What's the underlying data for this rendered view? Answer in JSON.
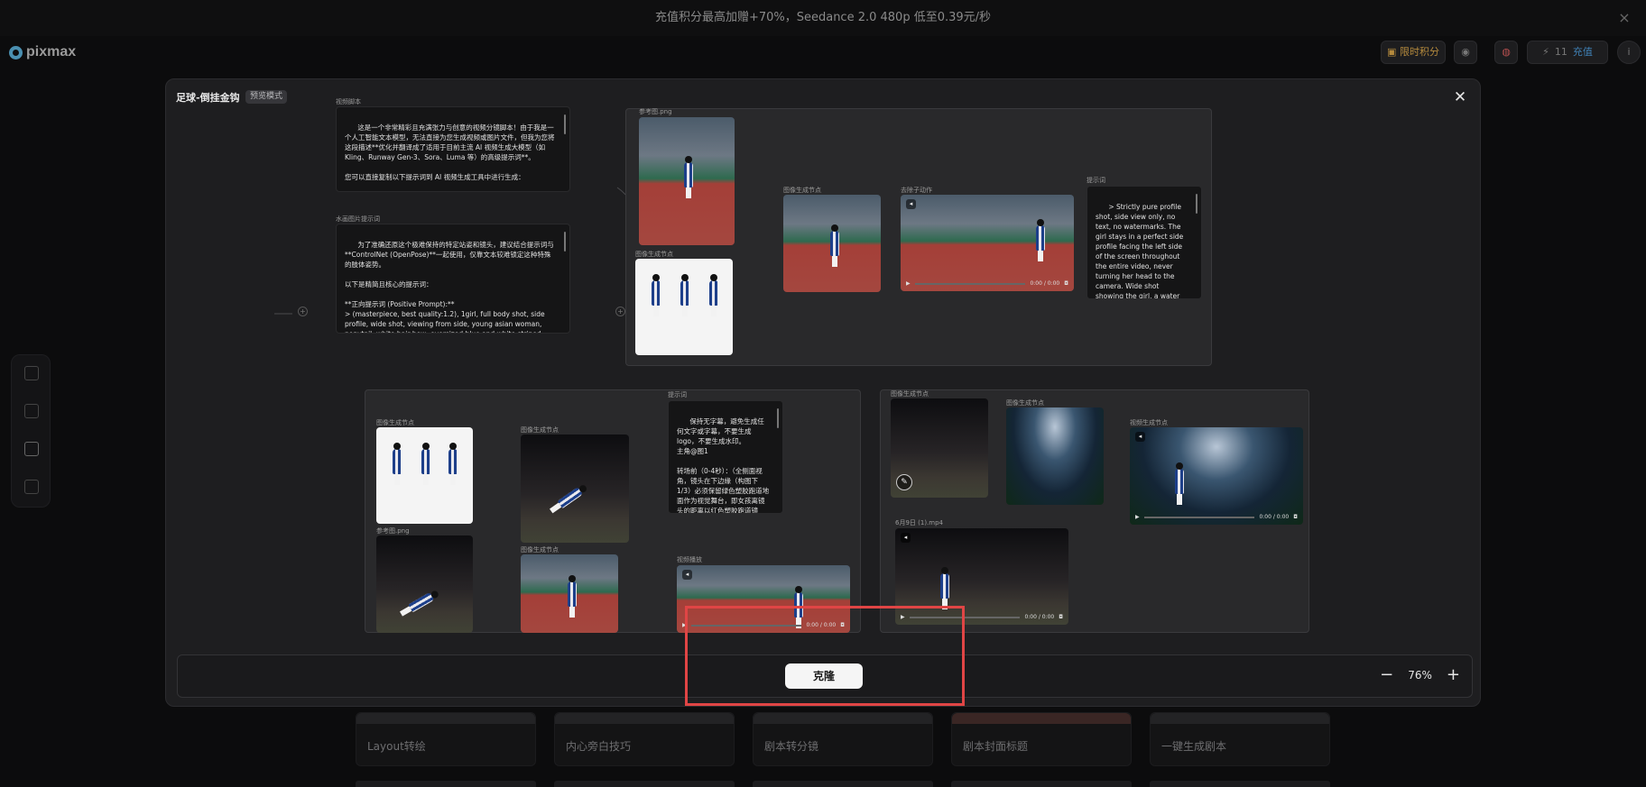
{
  "announcement": {
    "text": "充值积分最高加赠+70%，Seedance 2.0 480p 低至0.39元/秒",
    "close": "×"
  },
  "header": {
    "logo": "pixmax",
    "points_label": "限时积分",
    "energy_count": "11",
    "recharge_label": "充值"
  },
  "background_cards": [
    "Layout转绘",
    "内心旁白技巧",
    "剧本转分镜",
    "剧本封面标题",
    "一键生成剧本"
  ],
  "modal": {
    "title": "足球-倒挂金钩",
    "tag": "预览模式",
    "close": "✕",
    "clone_label": "克隆",
    "zoom": {
      "minus": "−",
      "value": "76%",
      "plus": "+"
    },
    "colors": {
      "highlight": "#e04545",
      "accent": "#3f7fb3"
    }
  },
  "nodes": {
    "video_script": {
      "label": "视频脚本",
      "text": "这是一个非常精彩且充满张力与创意的视频分镜脚本！由于我是一个人工智能文本模型，无法直接为您生成视频或图片文件，但我为您将这段描述**优化并翻译成了适用于目前主流 AI 视频生成大模型（如 Kling、Runway Gen-3、Sora、Luma 等）的高级提示词**。\n\n您可以直接复制以下提示词到 AI 视频生成工具中进行生成：\n\n### 🇨🇳 中文优化提示词（适用于 可灵 Kling 等国产模型）\n\n**正向提示词：**"
    },
    "image_prompt": {
      "label": "水画图片提示词",
      "text": "为了准确还原这个极难保持的特定站姿和镜头，建议结合提示词与**ControlNet (OpenPose)**一起使用，仅靠文本较难锁定这种特殊的肢体姿势。\n\n以下是精简且核心的提示词：\n\n**正向提示词 (Positive Prompt):**\n> (masterpiece, best quality:1.2), 1girl, full body shot, side profile, wide shot, viewing from side, young asian woman, ponytail, white hair bow, oversized blue and white striped sports jersey, off shoulder, white pantyhose, chunky white sneakers."
    },
    "ref_image_1": {
      "label": "参考图.png"
    },
    "image_gen_1": {
      "label": "图像生成节点"
    },
    "image_gen_2": {
      "label": "图像生成节点"
    },
    "video_1": {
      "label": "去除子动作",
      "time": "0:00 / 0:00"
    },
    "prompt_1": {
      "label": "提示词",
      "text": "> Strictly pure profile shot, side view only, no text, no watermarks. The girl stays in a perfect side profile facing the left side of the screen throughout the entire video, never turning her head to the camera. Wide shot showing the girl, a water bottle, and the red running track."
    },
    "image_gen_3": {
      "label": "图像生成节点"
    },
    "image_gen_4": {
      "label": "图像生成节点"
    },
    "ref_image_2": {
      "label": "参考图.png"
    },
    "image_gen_5": {
      "label": "图像生成节点"
    },
    "prompt_2": {
      "label": "提示词",
      "text": "保持无字幕，避免生成任何文字或字幕，不要生成 logo，不要生成水印。\n主角@图1\n\n转场前（0-4秒）：（全侧面视角，镜头在下边缘（构图下1/3）必须保留绿色塑胶跑道地面作为视觉舞台，即女孩离镜头的距离以红色塑胶跑道镜"
    },
    "video_2": {
      "label": "视频播放",
      "time": "0:00 / 0:00"
    },
    "image_gen_6": {
      "label": "图像生成节点"
    },
    "image_gen_7": {
      "label": "图像生成节点"
    },
    "video_3": {
      "label": "视频生成节点",
      "time": "0:00 / 0:00"
    },
    "video_4": {
      "label": "6月9日 (1).mp4",
      "time": "0:00 / 0:00"
    }
  }
}
